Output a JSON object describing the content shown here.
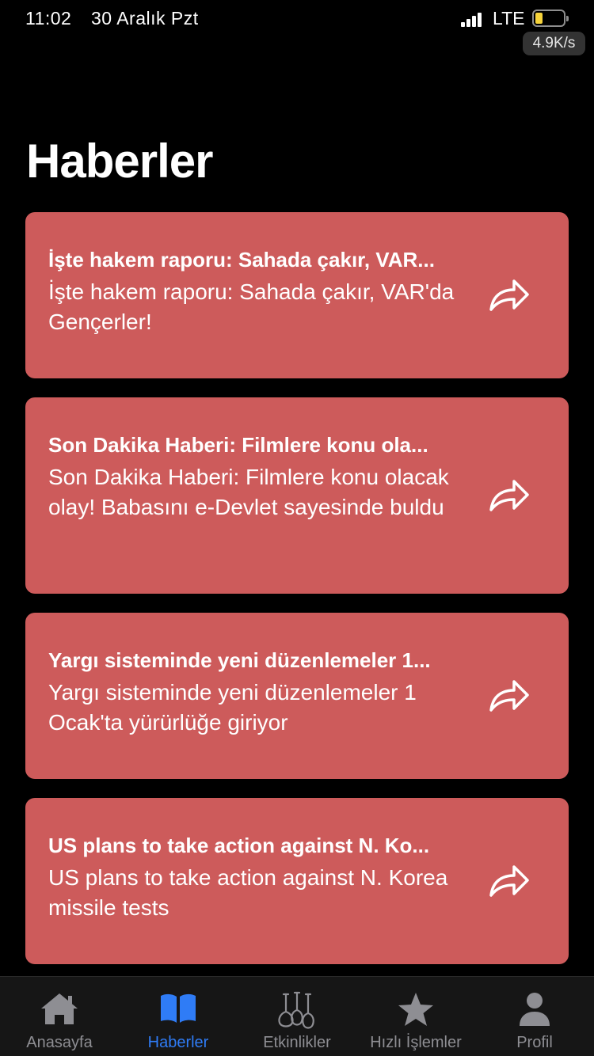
{
  "status_bar": {
    "time": "11:02",
    "date": "30 Aralık Pzt",
    "network_type": "LTE",
    "network_speed": "4.9K/s",
    "signal_icon": "signal-bars-icon",
    "battery_icon": "battery-low-icon",
    "battery_color": "#f6d33b"
  },
  "page": {
    "title": "Haberler"
  },
  "colors": {
    "card_background": "#cd5b5b",
    "active_tab": "#2f7cf6",
    "inactive_tab": "#8e8e93",
    "background": "#000000"
  },
  "news": [
    {
      "title": "İşte hakem raporu: Sahada çakır, VAR...",
      "body": "İşte hakem raporu: Sahada çakır, VAR'da Gençerler!",
      "icon": "share-arrow-icon"
    },
    {
      "title": "Son Dakika Haberi: Filmlere konu ola...",
      "body": "Son Dakika Haberi: Filmlere konu olacak olay! Babasını e-Devlet sayesinde buldu",
      "icon": "share-arrow-icon"
    },
    {
      "title": "Yargı sisteminde yeni düzenlemeler 1...",
      "body": "Yargı sisteminde yeni düzenlemeler 1 Ocak'ta yürürlüğe giriyor",
      "icon": "share-arrow-icon"
    },
    {
      "title": "US plans to take action against N. Ko...",
      "body": "US plans to take action against N. Korea missile tests",
      "icon": "share-arrow-icon"
    }
  ],
  "tabs": [
    {
      "label": "Anasayfa",
      "icon": "home-icon",
      "active": false
    },
    {
      "label": "Haberler",
      "icon": "book-icon",
      "active": true
    },
    {
      "label": "Etkinlikler",
      "icon": "guitars-icon",
      "active": false
    },
    {
      "label": "Hızlı İşlemler",
      "icon": "star-icon",
      "active": false
    },
    {
      "label": "Profil",
      "icon": "person-icon",
      "active": false
    }
  ]
}
